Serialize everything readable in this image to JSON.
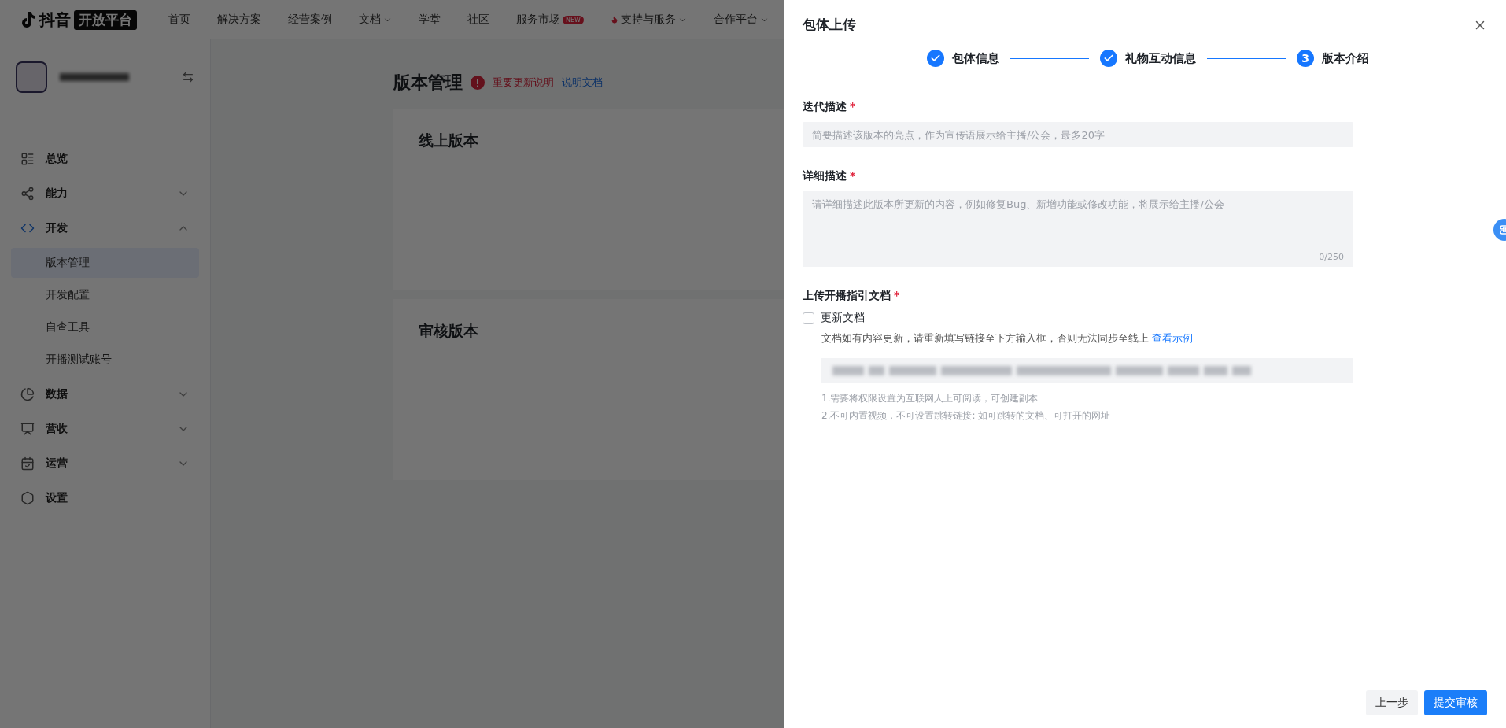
{
  "nav": {
    "logo": {
      "brand": "抖音",
      "badge": "开放平台"
    },
    "items": [
      {
        "label": "首页",
        "dropdown": false
      },
      {
        "label": "解决方案",
        "dropdown": false
      },
      {
        "label": "经营案例",
        "dropdown": false
      },
      {
        "label": "文档",
        "dropdown": true
      },
      {
        "label": "学堂",
        "dropdown": false
      },
      {
        "label": "社区",
        "dropdown": false
      },
      {
        "label": "服务市场",
        "dropdown": false,
        "badge": "NEW"
      },
      {
        "label": "支持与服务",
        "dropdown": true,
        "hot": true
      },
      {
        "label": "合作平台",
        "dropdown": true
      }
    ]
  },
  "sidebar": {
    "items": [
      {
        "label": "总览"
      },
      {
        "label": "能力",
        "expanded": false
      },
      {
        "label": "开发",
        "expanded": true,
        "children": [
          {
            "label": "版本管理",
            "selected": true
          },
          {
            "label": "开发配置",
            "selected": false
          },
          {
            "label": "自查工具",
            "selected": false
          },
          {
            "label": "开播测试账号",
            "selected": false
          }
        ]
      },
      {
        "label": "数据",
        "expanded": false
      },
      {
        "label": "营收",
        "expanded": false
      },
      {
        "label": "运营",
        "expanded": false
      },
      {
        "label": "设置"
      }
    ]
  },
  "main": {
    "title": "版本管理",
    "alert": "重要更新说明",
    "link": "说明文档",
    "cards": [
      "线上版本",
      "审核版本"
    ]
  },
  "drawer": {
    "title": "包体上传",
    "steps": [
      {
        "label": "包体信息",
        "done": true
      },
      {
        "label": "礼物互动信息",
        "done": true
      },
      {
        "label": "版本介绍",
        "done": false,
        "number": "3"
      }
    ],
    "fields": [
      {
        "kind": "input",
        "label": "迭代描述",
        "required_mark": "*",
        "placeholder": "简要描述该版本的亮点，作为宣传语展示给主播/公会，最多20字"
      },
      {
        "kind": "textarea",
        "label": "详细描述",
        "required_mark": "*",
        "placeholder": "请详细描述此版本所更新的内容，例如修复Bug、新增功能或修改功能，将展示给主播/公会",
        "counter": "0/250"
      },
      {
        "kind": "upload",
        "label": "上传开播指引文档",
        "required_mark": "*",
        "checkbox": {
          "label": "更新文档",
          "checked": false
        },
        "hint": "文档如有内容更新，请重新填写链接至下方输入框，否则无法同步至线上",
        "hint_link": "查看示例",
        "notes": [
          "1.需要将权限设置为互联网人上可阅读，可创建副本",
          "2.不可内置视频，不可设置跳转链接: 如可跳转的文档、可打开的网址"
        ]
      }
    ],
    "buttons": [
      {
        "label": "上一步",
        "primary": false
      },
      {
        "label": "提交审核",
        "primary": true
      }
    ]
  }
}
